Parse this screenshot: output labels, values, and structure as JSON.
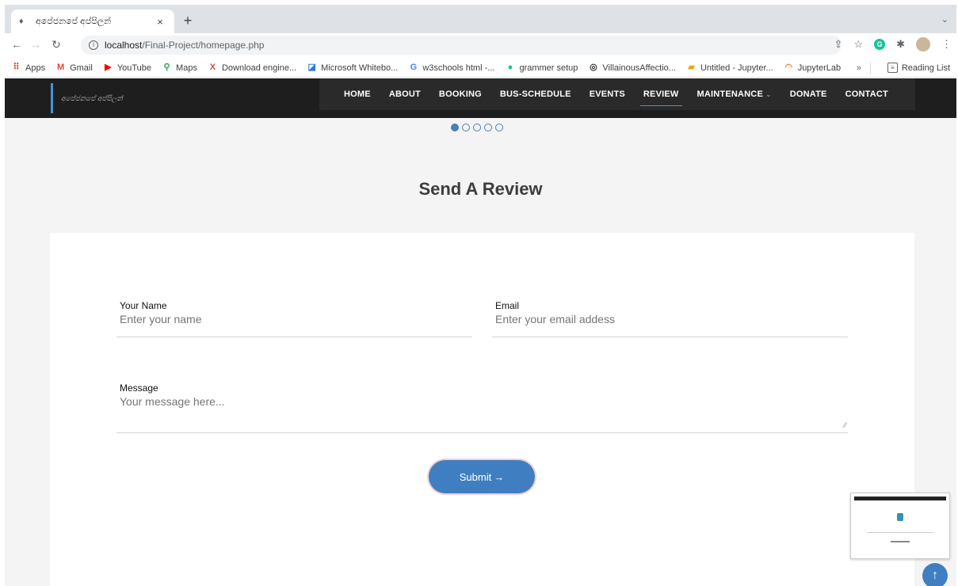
{
  "browser": {
    "tab_title": "අපේජනපේ අප්පිලන්",
    "new_tab": "+",
    "close_tab": "×",
    "url_host": "localhost",
    "url_path": "/Final-Project/homepage.php"
  },
  "bookmarks": [
    {
      "label": "Apps",
      "icon": "apps-grid-icon",
      "color": "#e8453c"
    },
    {
      "label": "Gmail",
      "icon": "gmail-icon",
      "color": "#ea4335"
    },
    {
      "label": "YouTube",
      "icon": "youtube-icon",
      "color": "#ff0000"
    },
    {
      "label": "Maps",
      "icon": "maps-pin-icon",
      "color": "#34a853"
    },
    {
      "label": "Download engine...",
      "icon": "x-icon",
      "color": "#e8453c"
    },
    {
      "label": "Microsoft Whitebo...",
      "icon": "whiteboard-icon",
      "color": "#2b7cd3"
    },
    {
      "label": "w3schools html -...",
      "icon": "google-icon",
      "color": "#4285f4"
    },
    {
      "label": "grammer setup",
      "icon": "grammarly-icon",
      "color": "#15c39a"
    },
    {
      "label": "VillainousAffectio...",
      "icon": "replit-icon",
      "color": "#333333"
    },
    {
      "label": "Untitled - Jupyter...",
      "icon": "jupyter-doc-icon",
      "color": "#f0a30a"
    },
    {
      "label": "JupyterLab",
      "icon": "jupyter-icon",
      "color": "#f37726"
    }
  ],
  "bookmarks_more": "»",
  "reading_list": "Reading List",
  "nav": {
    "items": [
      "HOME",
      "ABOUT",
      "BOOKING",
      "BUS-SCHEDULE",
      "EVENTS",
      "REVIEW",
      "MAINTENANCE",
      "DONATE",
      "CONTACT"
    ],
    "active": "REVIEW"
  },
  "logo_text": "අපේජනපේ අප්පිලන්",
  "carousel": {
    "count": 5,
    "active": 0
  },
  "review": {
    "title": "Send A Review",
    "name_label": "Your Name",
    "name_placeholder": "Enter your name",
    "email_label": "Email",
    "email_placeholder": "Enter your email addess",
    "message_label": "Message",
    "message_placeholder": "Your message here...",
    "submit_label": "Submit",
    "submit_arrow": "→"
  },
  "back_to_top": "↑",
  "colors": {
    "accent": "#3f7fc1",
    "header_bg": "#1e1e1e"
  }
}
